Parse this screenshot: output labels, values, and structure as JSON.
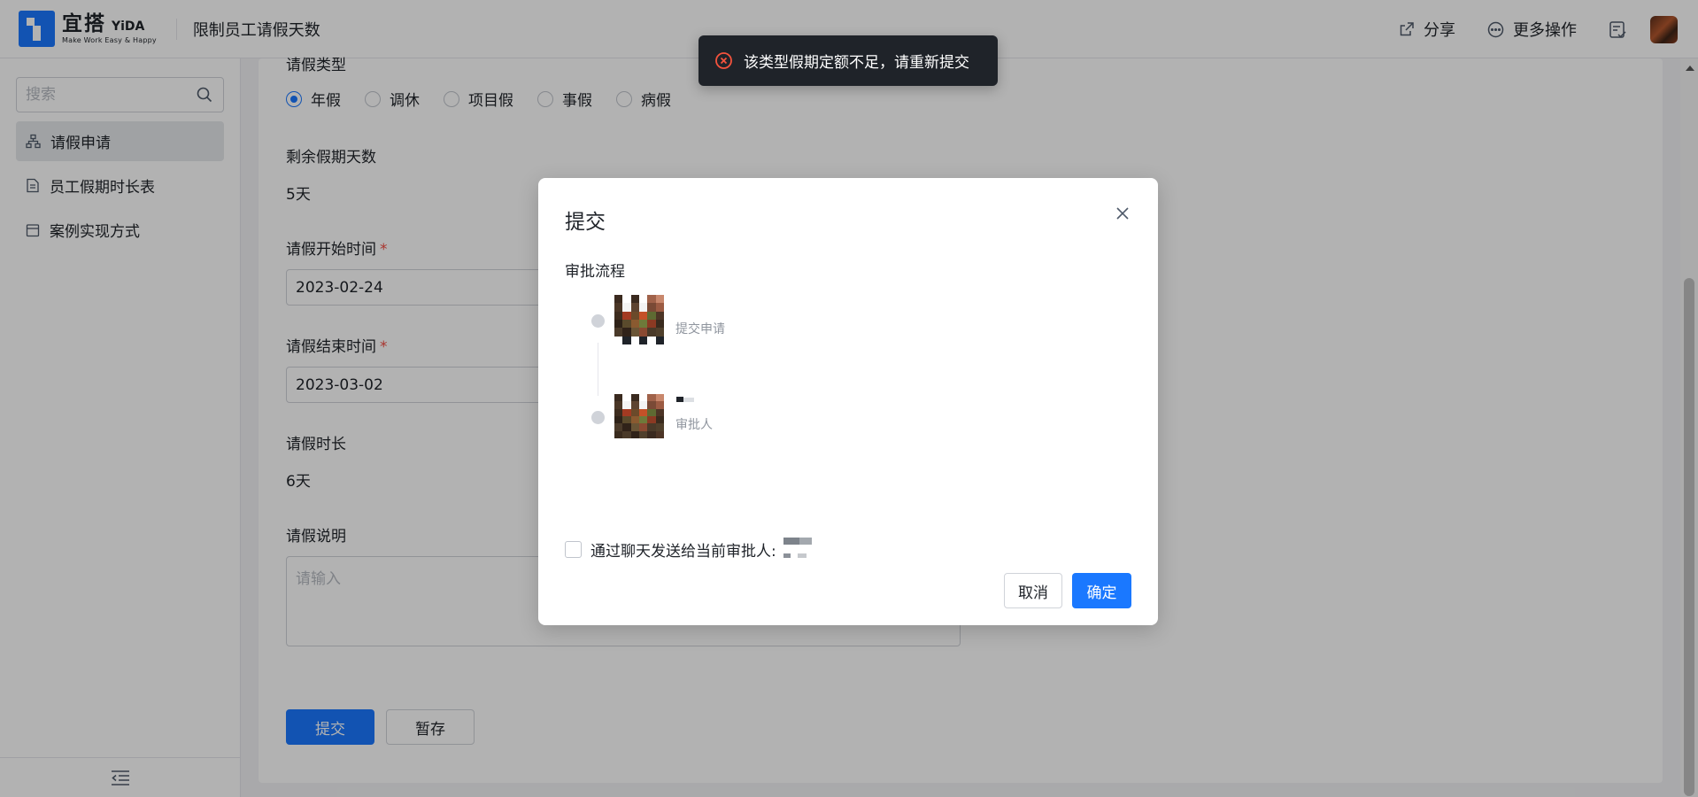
{
  "header": {
    "logo_cn": "宜搭",
    "logo_en": "YiDA",
    "logo_sub": "Make Work Easy & Happy",
    "app_title": "限制员工请假天数",
    "share_label": "分享",
    "more_label": "更多操作"
  },
  "sidebar": {
    "search_placeholder": "搜索",
    "items": [
      {
        "label": "请假申请",
        "icon": "org-chart-icon",
        "active": true
      },
      {
        "label": "员工假期时长表",
        "icon": "document-icon",
        "active": false
      },
      {
        "label": "案例实现方式",
        "icon": "calendar-icon",
        "active": false
      }
    ]
  },
  "form": {
    "leave_type_label": "请假类型",
    "leave_types": [
      "年假",
      "调休",
      "项目假",
      "事假",
      "病假"
    ],
    "selected_leave_type": "年假",
    "remaining_label": "剩余假期天数",
    "remaining_value": "5天",
    "start_label": "请假开始时间",
    "start_value": "2023-02-24",
    "end_label": "请假结束时间",
    "end_value": "2023-03-02",
    "required_mark": "*",
    "duration_label": "请假时长",
    "duration_value": "6天",
    "note_label": "请假说明",
    "note_placeholder": "请输入",
    "submit_label": "提交",
    "save_draft_label": "暂存"
  },
  "dialog": {
    "title": "提交",
    "flow_label": "审批流程",
    "steps": [
      {
        "role": "提交申请"
      },
      {
        "role": "审批人"
      }
    ],
    "notify_label": "通过聊天发送给当前审批人:",
    "cancel_label": "取消",
    "confirm_label": "确定"
  },
  "toast": {
    "message": "该类型假期定额不足，请重新提交",
    "status_color": "#f5533d"
  },
  "colors": {
    "primary": "#1a78ff",
    "required": "#f24b42"
  }
}
